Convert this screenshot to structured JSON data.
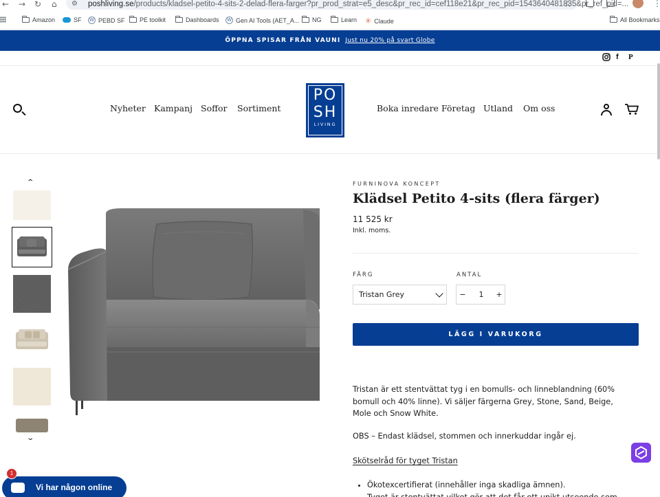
{
  "browser": {
    "url_host": "poshliving.se",
    "url_path": "/products/kladsel-petito-4-sits-2-delad-flera-farger?pr_prod_strat=e5_desc&pr_rec_id=cef118e21&pr_rec_pid=1543640481835&pr_ref_pid=...",
    "bookmarks": [
      "Amazon",
      "SF",
      "PEBD SF",
      "PE toolkit",
      "Dashboards",
      "Gen AI Tools (AET_A...",
      "NG",
      "Learn",
      "Claude"
    ],
    "all_bookmarks": "All Bookmarks"
  },
  "announcement": {
    "strong": "ÖPPNA SPISAR FRÅN VAUNI",
    "link": "Just nu 20% på svart Globe"
  },
  "header": {
    "nav_left": [
      "Nyheter",
      "Kampanj",
      "Soffor",
      "Sortiment"
    ],
    "nav_right": [
      "Boka inredare",
      "Företag",
      "Utland",
      "Om oss"
    ],
    "logo": {
      "line1": "PO",
      "line2": "SH",
      "line3": "LIVING"
    },
    "social": [
      "instagram-icon",
      "facebook-icon",
      "pinterest-icon"
    ]
  },
  "product": {
    "vendor": "FURNINOVA KONCEPT",
    "title": "Klädsel Petito 4-sits (flera färger)",
    "price": "11 525 kr",
    "tax_note": "Inkl. moms.",
    "color_label": "FÄRG",
    "color_value": "Tristan Grey",
    "qty_label": "ANTAL",
    "qty_value": "1",
    "qty_minus": "−",
    "qty_plus": "+",
    "add_to_cart": "LÄGG I VARUKORG",
    "description": "Tristan är ett stentvättat tyg i en bomulls- och linneblandning (60% bomull och 40% linne). Vi säljer färgerna Grey, Stone, Sand, Beige, Mole och Snow White.",
    "notice": "OBS – Endast klädsel, stommen och innerkuddar ingår ej.",
    "care_link": "Skötselråd för tyget Tristan",
    "bullets": [
      "Ökotexcertifierat (innehåller inga skadliga ämnen).",
      "Tyget är stentvättat vilket gör att det får ett unikt utseende som"
    ]
  },
  "chat": {
    "label": "Vi har någon online",
    "unread": "1"
  },
  "colors": {
    "brand_blue": "#063e93",
    "sofa_grey": "#6b6b6b"
  }
}
